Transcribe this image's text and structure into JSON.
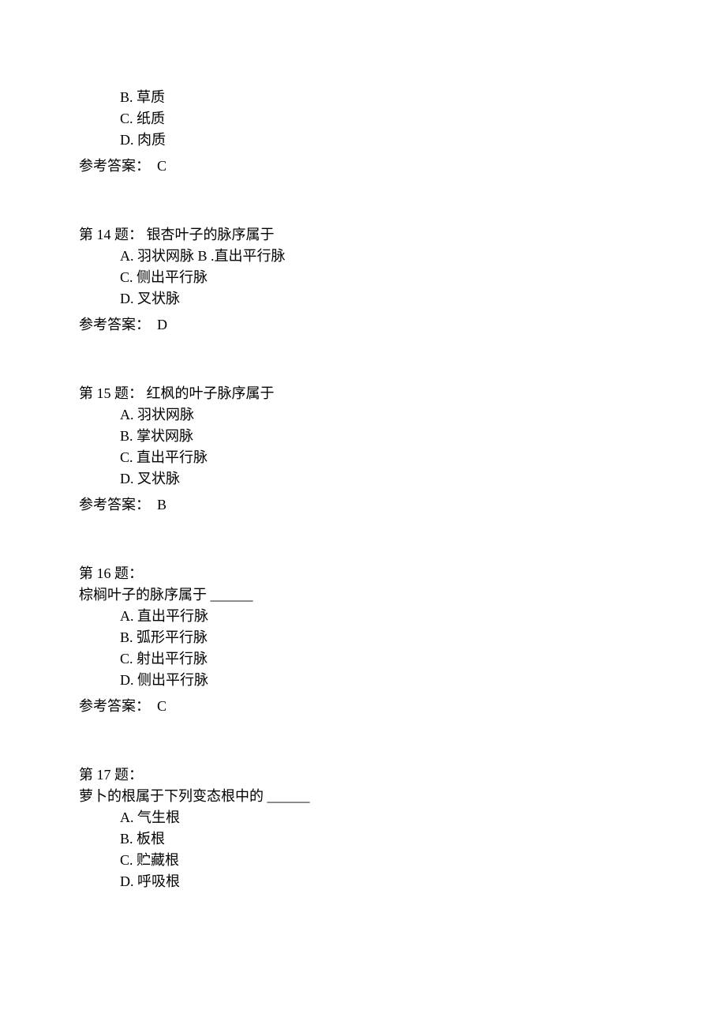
{
  "q13_continued": {
    "options": {
      "B": "B. 草质",
      "C": "C. 纸质",
      "D": "D. 肉质"
    },
    "answer_label": "参考答案：",
    "answer_value": "C"
  },
  "q14": {
    "title": "第  14 题：   银杏叶子的脉序属于",
    "options": {
      "A": "A. 羽状网脉",
      "B": "B .直出平行脉",
      "C": "C. 侧出平行脉",
      "D": "D. 叉状脉"
    },
    "answer_label": "参考答案：",
    "answer_value": "D"
  },
  "q15": {
    "title": "第  15 题：   红枫的叶子脉序属于",
    "options": {
      "A": "A. 羽状网脉",
      "B": "B. 掌状网脉",
      "C": "C. 直出平行脉",
      "D": "D. 叉状脉"
    },
    "answer_label": "参考答案：",
    "answer_value": "B"
  },
  "q16": {
    "title": "第  16 题：",
    "stem": "棕榈叶子的脉序属于  ______",
    "options": {
      "A": "A. 直出平行脉",
      "B": "B. 弧形平行脉",
      "C": "C. 射出平行脉",
      "D": "D.   侧出平行脉"
    },
    "answer_label": "参考答案：",
    "answer_value": "C"
  },
  "q17": {
    "title": "第  17 题：",
    "stem": "萝卜的根属于下列变态根中的   ______",
    "options": {
      "A": "A. 气生根",
      "B": "B. 板根",
      "C": "C. 贮藏根",
      "D": "D. 呼吸根"
    }
  }
}
